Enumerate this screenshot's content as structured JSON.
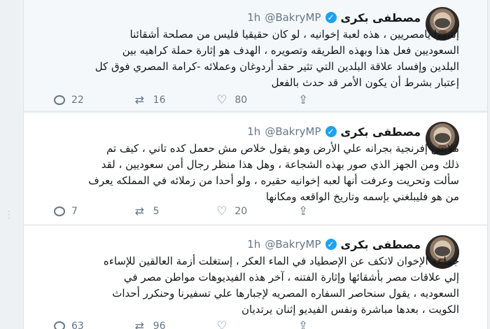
{
  "tweets": [
    {
      "author": {
        "name": "مصطفى بكرى",
        "handle": "@BakryMP",
        "time": "1h"
      },
      "text": "إنتبهوا يامصريين ، هذه لعبة إخوانيه ، لو كان حقيقيا فليس من مصلحة أشقائنا\nالسعوديين  فعل هذا وبهذه الطريقه وتصويره ، الهدف هو إثارة حملة كراهيه بين\nالبلدين وإفساد علاقة البلدين التي تثير حقد أردوغان وعملائه -كرامة المصري فوق كل\nإعتبار بشرط أن يكون الأمر قد حدث بالفعل",
      "stats": {
        "replies": "22",
        "retweets": "16",
        "likes": "80"
      }
    },
    {
      "author": {
        "name": "مصطفى بكرى",
        "handle": "@BakryMP",
        "time": "1h"
      },
      "text": "ملابس إفرنجية بجرانه علي الأرض وهو يقول خلاص مش حعمل كده تاني ، كيف تم\nذلك ومن الجهز الذي صور بهذه الشجاعة ، وهل هذا منظر رجال أمن سعوديين ، لقد\nسألت وتحريت وعرفت أنها لعبه إخوانيه حقيره ، ولو أحدا من زملائه في المملكه يعرف\nمن هو فليبلغني بإسمه وتاريخ الواقعه ومكانها",
      "stats": {
        "replies": "7",
        "retweets": "5",
        "likes": "20"
      }
    },
    {
      "author": {
        "name": "مصطفى بكرى",
        "handle": "@BakryMP",
        "time": "1h"
      },
      "text": "جماعة الإخوان لاتكف عن الإصطياد في الماء العكر ، إستغلت أزمة العالقين للإساءه\nإلي علاقات مصر بأشقائها وإثارة الفتنه ، آخر هذه الفيديوهات مواطن مصر في\nالسعوديه ، يقول سنحاصر السفاره المصريه لإجبارها علي تسفيرنا وحنكرر أحداث\nالكويت ، بعدها مباشرة ونفس الفيديو إثنان يرتديان",
      "stats": {
        "replies": "63",
        "retweets": "96",
        "likes": ""
      }
    }
  ],
  "colors": {
    "verified": "#1da1f2",
    "muted": "#657786"
  },
  "icons": {
    "reply": "comment-icon",
    "retweet": "retweet-icon",
    "like": "heart-icon",
    "share": "share-icon",
    "verified": "verified-badge-icon"
  }
}
